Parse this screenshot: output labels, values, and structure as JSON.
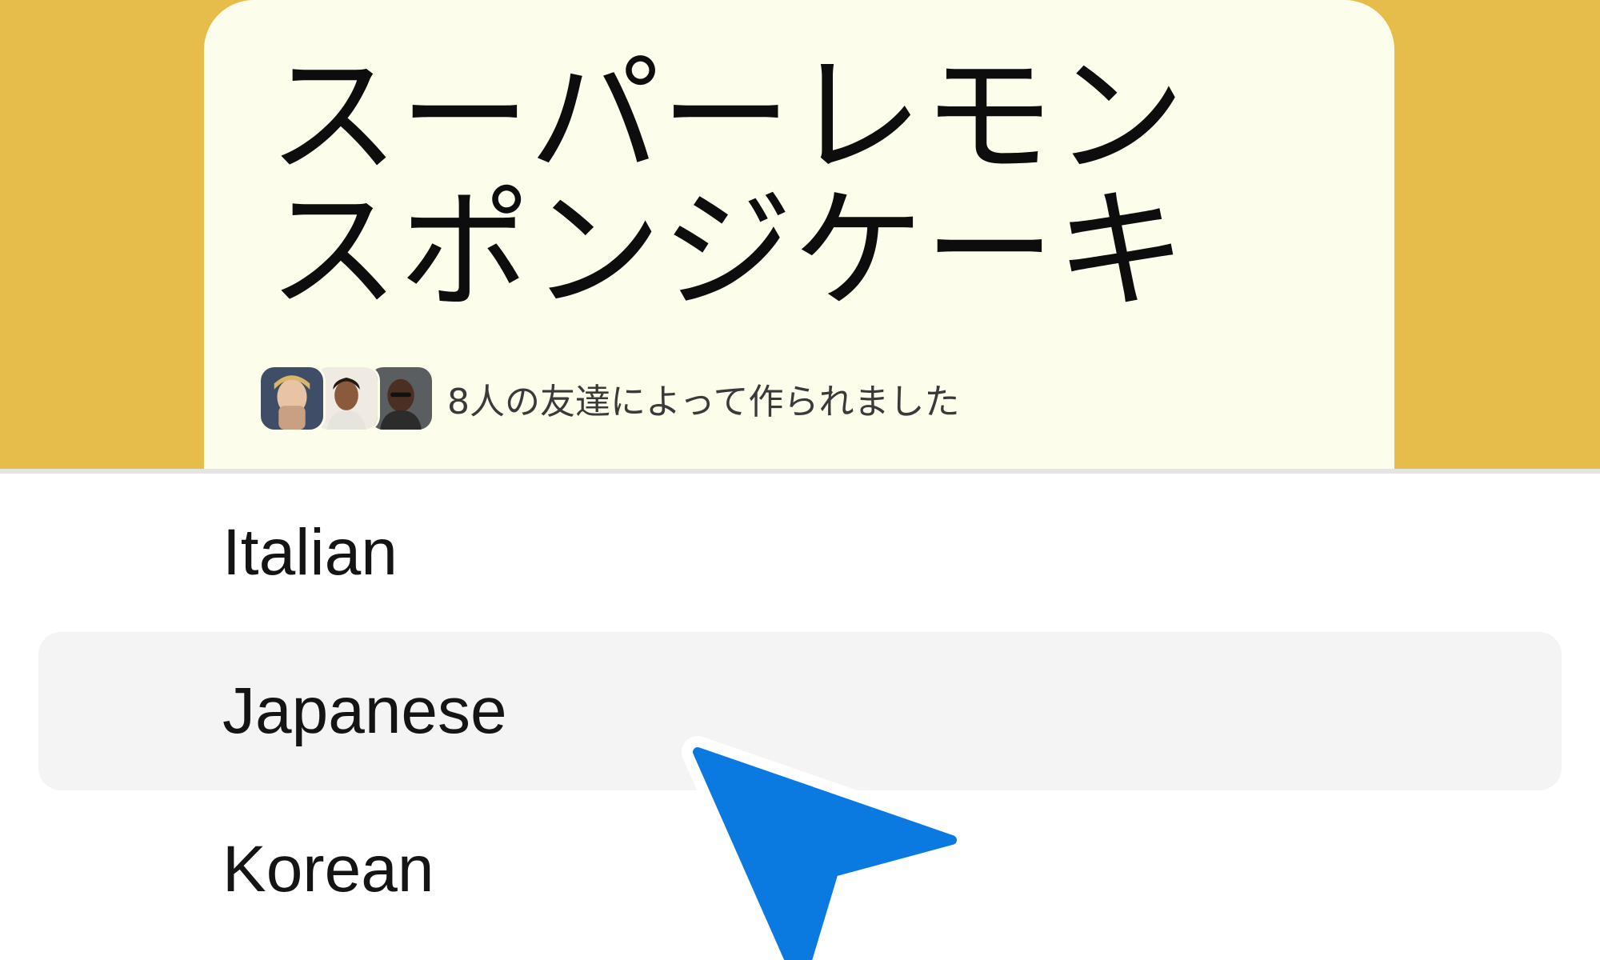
{
  "recipe_card": {
    "title_lines": [
      "スーパーレモン",
      "スポンジケーキ"
    ],
    "byline": "8人の友達によって作られました",
    "avatar_count": 3
  },
  "language_menu": {
    "items": [
      {
        "label": "Italian",
        "highlighted": false
      },
      {
        "label": "Japanese",
        "highlighted": true
      },
      {
        "label": "Korean",
        "highlighted": false
      }
    ]
  },
  "colors": {
    "banner": "#e6bd4a",
    "card": "#fdfdec",
    "highlight_row": "#f4f4f4",
    "cursor": "#0b7ae0"
  },
  "icons": {
    "pointer": "pointer-cursor-icon"
  }
}
